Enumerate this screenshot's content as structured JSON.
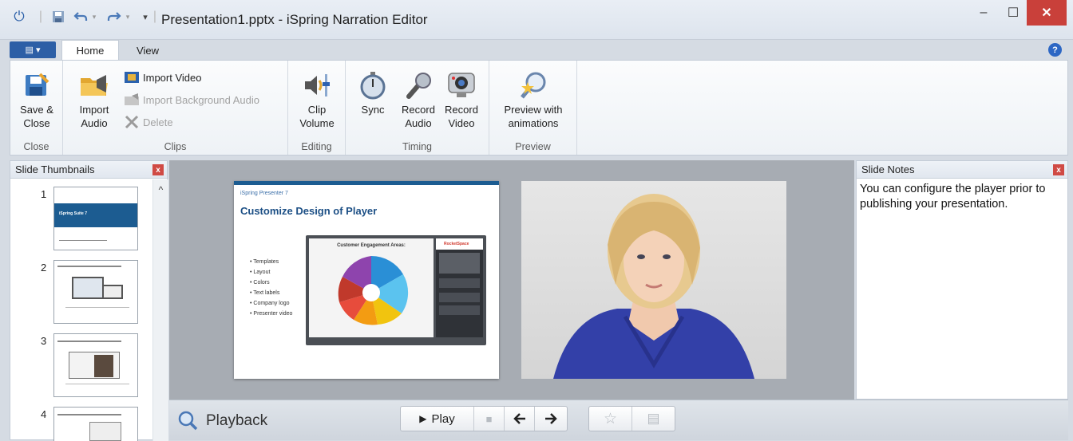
{
  "window": {
    "title": "Presentation1.pptx - iSpring Narration Editor",
    "minimize": "–",
    "maximize": "☐",
    "close": "✕"
  },
  "quick_access": {
    "menu_glyph": "▾"
  },
  "tabs": {
    "file_glyph": "▤ ▾",
    "home": "Home",
    "view": "View",
    "help": "?"
  },
  "ribbon": {
    "groups": [
      {
        "label": "Close"
      },
      {
        "label": "Clips"
      },
      {
        "label": "Editing"
      },
      {
        "label": "Timing"
      },
      {
        "label": "Preview"
      }
    ],
    "save_close": "Save &\nClose",
    "import_audio": "Import\nAudio",
    "import_video": "Import Video",
    "import_bg_audio": "Import Background Audio",
    "delete": "Delete",
    "clip_volume": "Clip\nVolume",
    "sync": "Sync",
    "record_audio": "Record\nAudio",
    "record_video": "Record\nVideo",
    "preview_animations": "Preview with\nanimations"
  },
  "thumbnails": {
    "header": "Slide Thumbnails",
    "close": "x",
    "scroll_up": "^",
    "items": [
      {
        "number": "1",
        "title": "iSpring Suite 7"
      },
      {
        "number": "2"
      },
      {
        "number": "3"
      },
      {
        "number": "4"
      }
    ]
  },
  "slide": {
    "brand": "iSpring Presenter 7",
    "title": "Customize Design of Player",
    "bullets": [
      "• Templates",
      "• Layout",
      "• Colors",
      "• Text labels",
      "• Company logo",
      "• Presenter video"
    ],
    "chart_title": "Customer Engagement Areas:",
    "player_logo": "RocketSpace"
  },
  "notes": {
    "header": "Slide Notes",
    "close": "x",
    "text": "You can configure the player prior to publishing your presentation."
  },
  "playback": {
    "label": "Playback",
    "play": "Play",
    "play_glyph": "▶",
    "stop_glyph": "■",
    "prev_glyph": "🡄",
    "next_glyph": "🡆",
    "star_glyph": "☆",
    "page_glyph": "▤"
  },
  "colors": {
    "accent": "#2d5fa6",
    "close_red": "#c9403a",
    "canvas_gray": "#a7acb3"
  }
}
